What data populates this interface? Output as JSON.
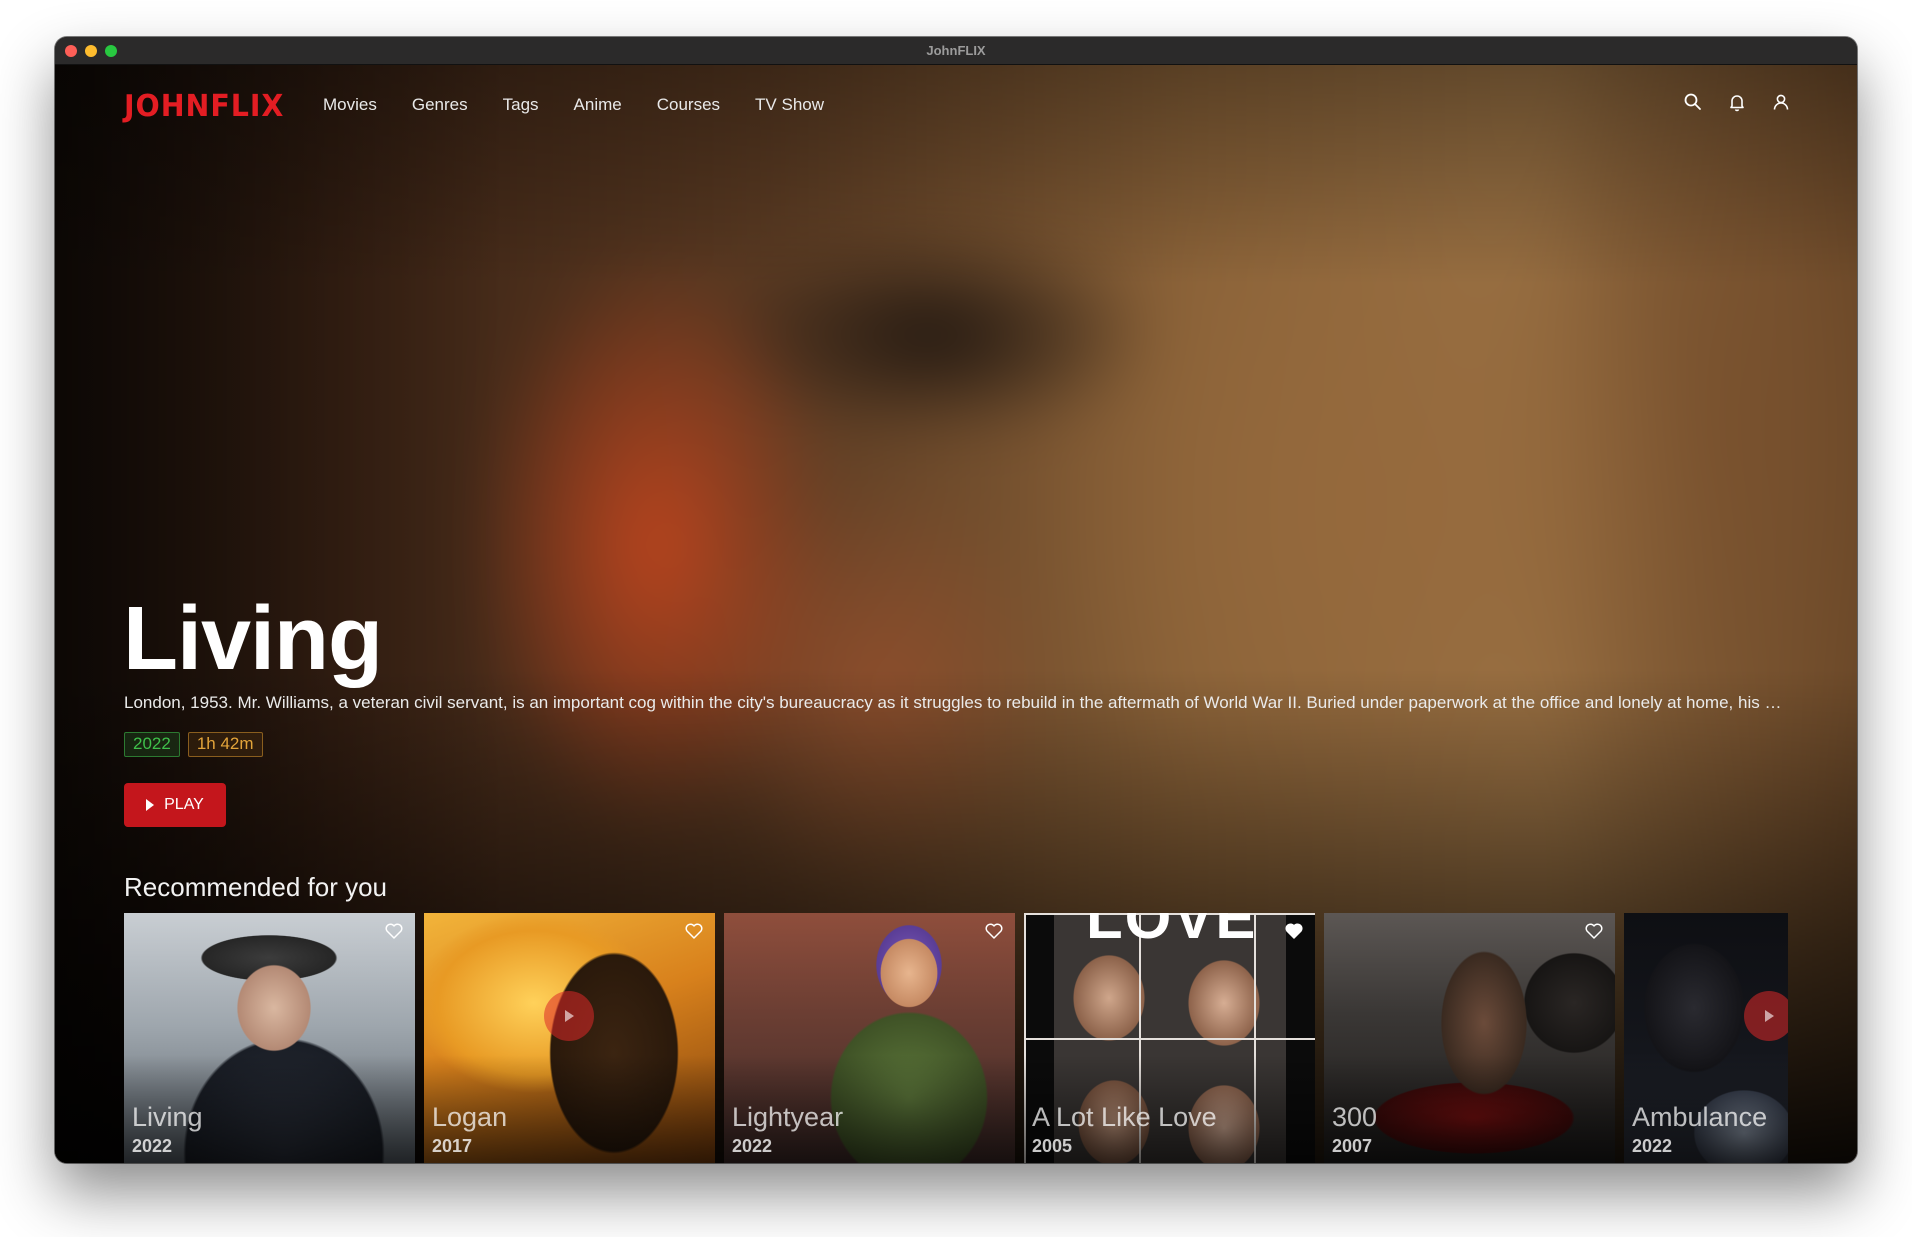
{
  "window": {
    "title": "JohnFLIX"
  },
  "nav": {
    "logo": "JOHNFLIX",
    "items": [
      "Movies",
      "Genres",
      "Tags",
      "Anime",
      "Courses",
      "TV Show"
    ]
  },
  "hero": {
    "title": "Living",
    "description": "London, 1953. Mr. Williams, a veteran civil servant, is an important cog within the city's bureaucracy as it struggles to rebuild in the aftermath of World War II. Buried under paperwork at the office and lonely at home, his life h...",
    "year": "2022",
    "duration": "1h 42m",
    "play_label": "PLAY"
  },
  "recommended": {
    "heading": "Recommended for you",
    "items": [
      {
        "title": "Living",
        "year": "2022",
        "favorited": false
      },
      {
        "title": "Logan",
        "year": "2017",
        "favorited": false
      },
      {
        "title": "Lightyear",
        "year": "2022",
        "favorited": false
      },
      {
        "title": "A Lot Like Love",
        "year": "2005",
        "favorited": true,
        "art_text": "LOVE"
      },
      {
        "title": "300",
        "year": "2007",
        "favorited": false
      },
      {
        "title": "Ambulance",
        "year": "2022",
        "favorited": false
      }
    ]
  },
  "colors": {
    "brand": "#e31d23",
    "play_button": "#c4161c",
    "year_badge": "#3fbf4a",
    "duration_badge": "#e3a43a"
  },
  "icons": [
    "search-icon",
    "bell-icon",
    "user-icon",
    "heart-icon",
    "play-icon"
  ]
}
